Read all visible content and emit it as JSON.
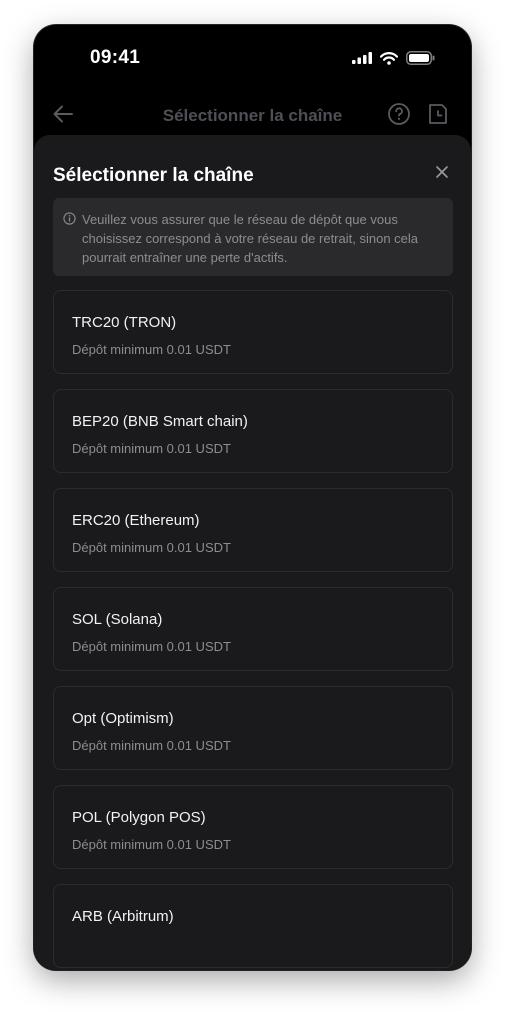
{
  "status_bar": {
    "time": "09:41"
  },
  "nav": {
    "title": "Sélectionner la chaîne"
  },
  "sheet": {
    "title": "Sélectionner la chaîne",
    "notice": "Veuillez vous assurer que le réseau de dépôt que vous choisissez correspond à votre réseau de retrait, sinon cela pourrait entraîner une perte d'actifs.",
    "chains": [
      {
        "name": "TRC20 (TRON)",
        "min_deposit": "Dépôt minimum 0.01 USDT"
      },
      {
        "name": "BEP20 (BNB Smart chain)",
        "min_deposit": "Dépôt minimum 0.01 USDT"
      },
      {
        "name": "ERC20 (Ethereum)",
        "min_deposit": "Dépôt minimum 0.01 USDT"
      },
      {
        "name": "SOL (Solana)",
        "min_deposit": "Dépôt minimum 0.01 USDT"
      },
      {
        "name": "Opt (Optimism)",
        "min_deposit": "Dépôt minimum 0.01 USDT"
      },
      {
        "name": "POL (Polygon POS)",
        "min_deposit": "Dépôt minimum 0.01 USDT"
      },
      {
        "name": "ARB (Arbitrum)",
        "min_deposit": ""
      }
    ]
  },
  "icons": {
    "back": "arrow-left-icon",
    "help": "question-circle-icon",
    "history": "clock-document-icon",
    "close": "close-icon",
    "info": "info-circle-icon",
    "signal": "cellular-signal-icon",
    "wifi": "wifi-icon",
    "battery": "battery-icon"
  }
}
